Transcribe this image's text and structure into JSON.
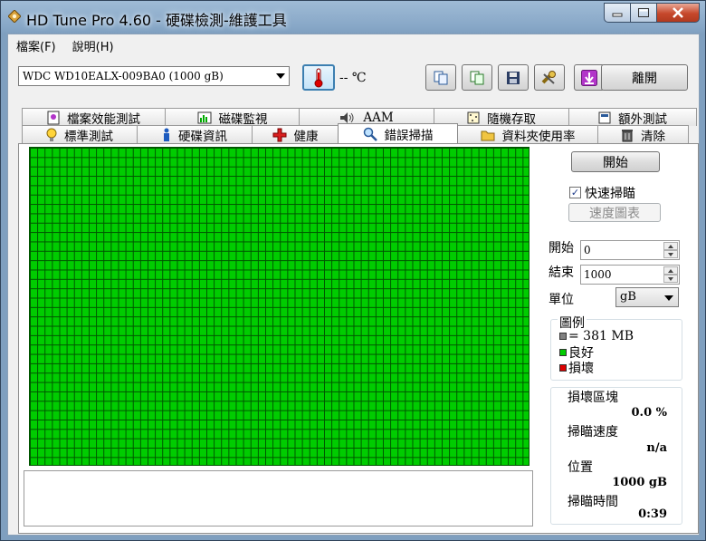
{
  "window": {
    "title": "HD Tune Pro 4.60 - 硬碟檢測-維護工具"
  },
  "menu": {
    "items": [
      "檔案(F)",
      "說明(H)"
    ]
  },
  "toolbar": {
    "drive": "WDC WD10EALX-009BA0 (1000 gB)",
    "temperature": "-- ℃",
    "exit_label": "離開"
  },
  "tabs": {
    "top_row": [
      {
        "label": "檔案效能測試",
        "icon": "file-benchmark-icon"
      },
      {
        "label": "磁碟監視",
        "icon": "disk-monitor-icon"
      },
      {
        "label": "AAM",
        "icon": "speaker-icon"
      },
      {
        "label": "隨機存取",
        "icon": "random-access-icon"
      },
      {
        "label": "額外測試",
        "icon": "extra-tests-icon"
      }
    ],
    "bottom_row": [
      {
        "label": "標準測試",
        "icon": "benchmark-icon"
      },
      {
        "label": "硬碟資訊",
        "icon": "info-icon"
      },
      {
        "label": "健康",
        "icon": "health-cross-icon"
      },
      {
        "label": "錯誤掃描",
        "icon": "magnifier-icon",
        "active": true
      },
      {
        "label": "資料夾使用率",
        "icon": "folder-icon"
      },
      {
        "label": "清除",
        "icon": "trash-icon"
      }
    ]
  },
  "scan": {
    "start_button": "開始",
    "quick_scan_label": "快速掃瞄",
    "quick_scan_checked": true,
    "speed_map_button": "速度圖表",
    "start_label": "開始",
    "start_value": "0",
    "end_label": "結束",
    "end_value": "1000",
    "unit_label": "單位",
    "unit_value": "gB"
  },
  "legend": {
    "title": "圖例",
    "block_size": "= 381 MB",
    "good": "良好",
    "damaged": "損壞",
    "colors": {
      "block": "#808080",
      "good": "#00cc00",
      "damaged": "#dd0000"
    }
  },
  "stats": {
    "damaged_blocks_label": "損壞區塊",
    "damaged_blocks_value": "0.0 %",
    "scan_speed_label": "掃瞄速度",
    "scan_speed_value": "n/a",
    "position_label": "位置",
    "position_value": "1000 gB",
    "scan_time_label": "掃瞄時間",
    "scan_time_value": "0:39"
  }
}
